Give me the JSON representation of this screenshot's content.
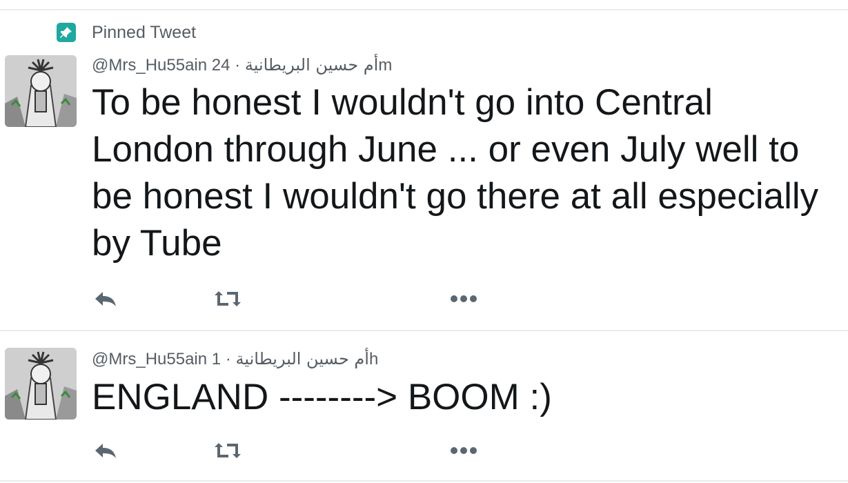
{
  "pinned": {
    "label": "Pinned Tweet",
    "icon": "pin-icon",
    "icon_color": "#1fa8a0"
  },
  "tweets": [
    {
      "handle": "@Mrs_Hu55ain",
      "display_name": "أم حسين البريطانية",
      "separator": "·",
      "time": "24m",
      "text": "To be honest I wouldn't go into Central London through June ... or even July well to be honest I wouldn't go there at all especially by Tube",
      "actions": [
        "reply-icon",
        "retweet-icon",
        "more-icon"
      ]
    },
    {
      "handle": "@Mrs_Hu55ain",
      "display_name": "أم حسين البريطانية",
      "separator": "·",
      "time": "1h",
      "text": "ENGLAND --------> BOOM :)",
      "actions": [
        "reply-icon",
        "retweet-icon",
        "more-icon"
      ]
    }
  ],
  "colors": {
    "text": "#14171a",
    "meta": "#555c62",
    "action_icon": "#5b6770",
    "divider": "#e6ecf0"
  }
}
